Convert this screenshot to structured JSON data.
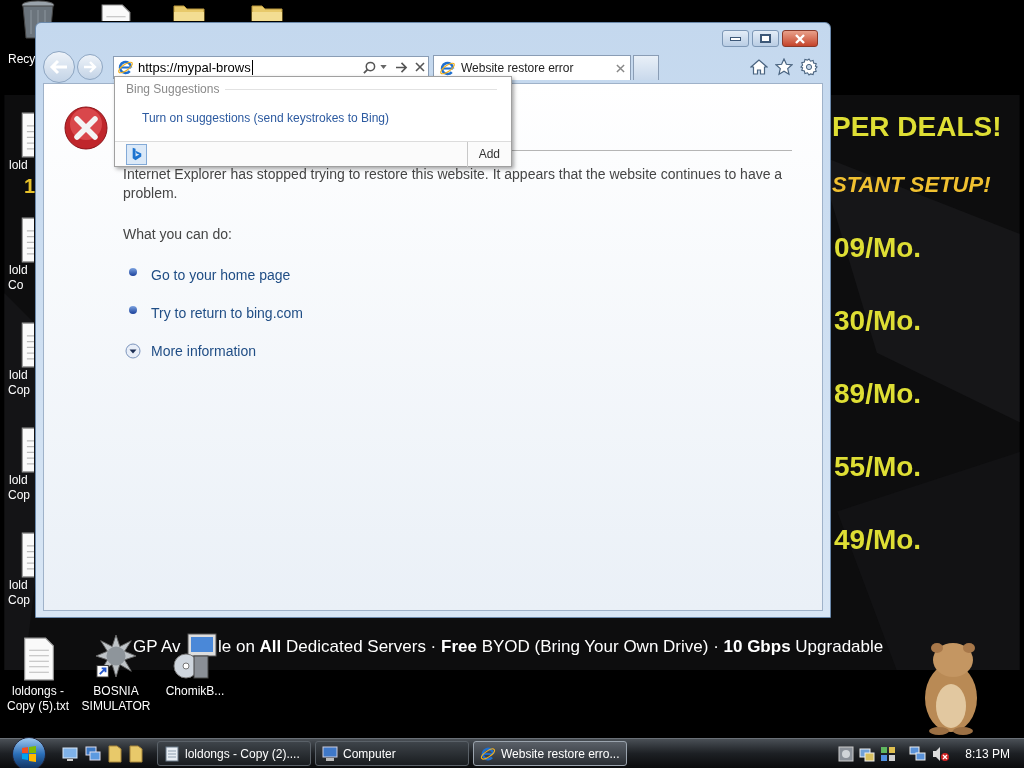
{
  "desktop": {
    "top_icons": [
      {
        "kind": "recycle_bin",
        "label": "Recy"
      },
      {
        "kind": "file"
      },
      {
        "kind": "folder"
      },
      {
        "kind": "folder"
      }
    ],
    "left_icons": [
      {
        "kind": "file",
        "label_lines": [
          "lold"
        ]
      },
      {
        "kind": "file",
        "label_lines": [
          "lold",
          "Co"
        ]
      },
      {
        "kind": "file",
        "label_lines": [
          "lold",
          "Cop"
        ]
      },
      {
        "kind": "file",
        "label_lines": [
          "lold",
          "Cop"
        ]
      },
      {
        "kind": "file",
        "label_lines": [
          "lold",
          "Cop"
        ]
      }
    ],
    "bottom_icons": [
      {
        "kind": "file",
        "label": "loldongs - Copy (5).txt"
      },
      {
        "kind": "program",
        "label": "BOSNIA SIMULATOR"
      },
      {
        "kind": "installer",
        "label": "ChomikB..."
      }
    ]
  },
  "wallpaper": {
    "headline": "PER DEALS!",
    "subhead": "STANT SETUP!",
    "fragment": "1",
    "prices": [
      "09/Mo.",
      "30/Mo.",
      "89/Mo.",
      "55/Mo.",
      "49/Mo."
    ],
    "banner_parts": [
      "GP Av",
      "le on **All** Dedicated Servers · **Free** BYOD (Bring Your Own Drive) · **10 Gbps** Upgradable"
    ]
  },
  "browser": {
    "address": {
      "value": "https://mypal-brows"
    },
    "tabs": [
      {
        "title": "Website restore error",
        "selected": true
      }
    ],
    "suggestions": {
      "header": "Bing Suggestions",
      "items": [
        "Turn on suggestions (send keystrokes to Bing)"
      ],
      "add_button": "Add"
    },
    "page": {
      "paragraph": "Internet Explorer has stopped trying to restore this website. It appears that the website continues to have a problem.",
      "subheading": "What you can do:",
      "actions": [
        {
          "kind": "bullet",
          "text": "Go to your home page"
        },
        {
          "kind": "bullet",
          "text": "Try to return to bing.com"
        },
        {
          "kind": "expander",
          "text": "More information",
          "expanded": false
        }
      ]
    }
  },
  "taskbar": {
    "tasks": [
      {
        "kind": "notepad",
        "label": "loldongs - Copy (2)....",
        "selected": false
      },
      {
        "kind": "computer",
        "label": "Computer",
        "selected": false
      },
      {
        "kind": "ie",
        "label": "Website restore erro...",
        "selected": true
      }
    ],
    "clock": "8:13 PM"
  }
}
